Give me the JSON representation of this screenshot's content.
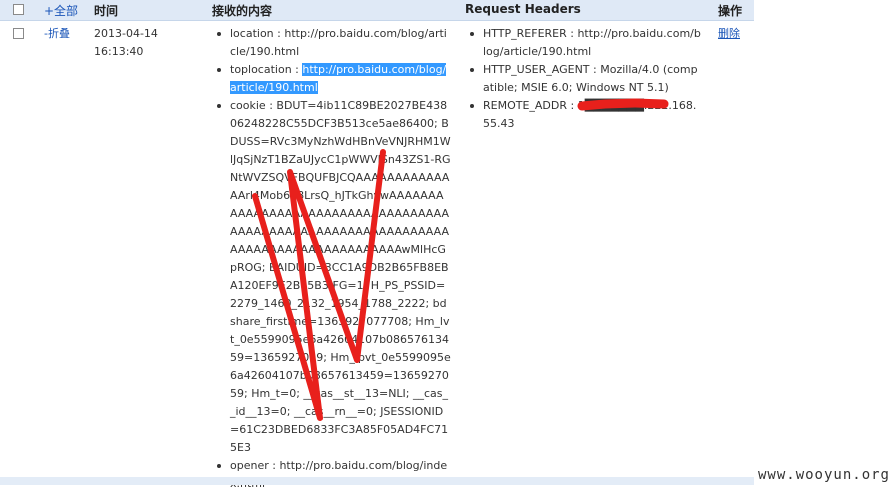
{
  "header": {
    "select_all": "+全部",
    "time": "时间",
    "received": "接收的内容",
    "request_headers": "Request Headers",
    "actions": "操作"
  },
  "row": {
    "collapse": "-折叠",
    "date": "2013-04-14",
    "time": "16:13:40",
    "received": {
      "location": "location : http://pro.baidu.com/blog/article/190.html",
      "toplocation_key": "toplocation : ",
      "toplocation_val": "http://pro.baidu.com/blog/article/190.html",
      "cookie": "cookie : BDUT=4ib11C89BE2027BE43806248228C55DCF3B513ce5ae86400; BDUSS=RVc3MyNzhWdHBnVeVNJRHM1WlJqSjNzT1BZaUJycC1pWWVISn43ZS1-RGNtWVZSQVFBQUFBJCQAAAAAAAAAAAAAArl4Mob678LrsQ_hJTkGhvwAAAAAAAAAAAAAAAAAAAAAAAAAAAAAAAAAAAAAAAAAAAAAAAAAAAAAAAAAAAAAAAAAAAAAAAAAAAAAAAAAAAAAwMlHcGpROG; BAIDUID=3CC1A9DB2B65FB8EBA120EF9E2B05B3:FG=1; H_PS_PSSID=2279_1460_2132_1954_1788_2222; bdshare_firstime=1365927077708; Hm_lvt_0e5599095e6a42604107b08657613459=1365927019; Hm_lpvt_0e5599095e6a42604107b08657613459=1365927059; Hm_t=0; __cas__st__13=NLI; __cas__id__13=0; __cas__rn__=0; JSESSIONID=61C23DBED6833FC3A85F05AD4FC715E3",
      "opener": "opener : http://pro.baidu.com/blog/index.html"
    },
    "headers": {
      "referer": "HTTP_REFERER : http://pro.baidu.com/blog/article/190.html",
      "user_agent": "HTTP_USER_AGENT : Mozilla/4.0 (compatible; MSIE 6.0; Windows NT 5.1)",
      "remote_addr": "REMOTE_ADDR : 1███████.222.168.55.43"
    },
    "delete": "删除"
  },
  "watermark": "www.wooyun.org",
  "colors": {
    "header_bg": "#dfe9f6",
    "link": "#1a55b8",
    "highlight": "#3399ff",
    "scribble": "#e8201c"
  }
}
